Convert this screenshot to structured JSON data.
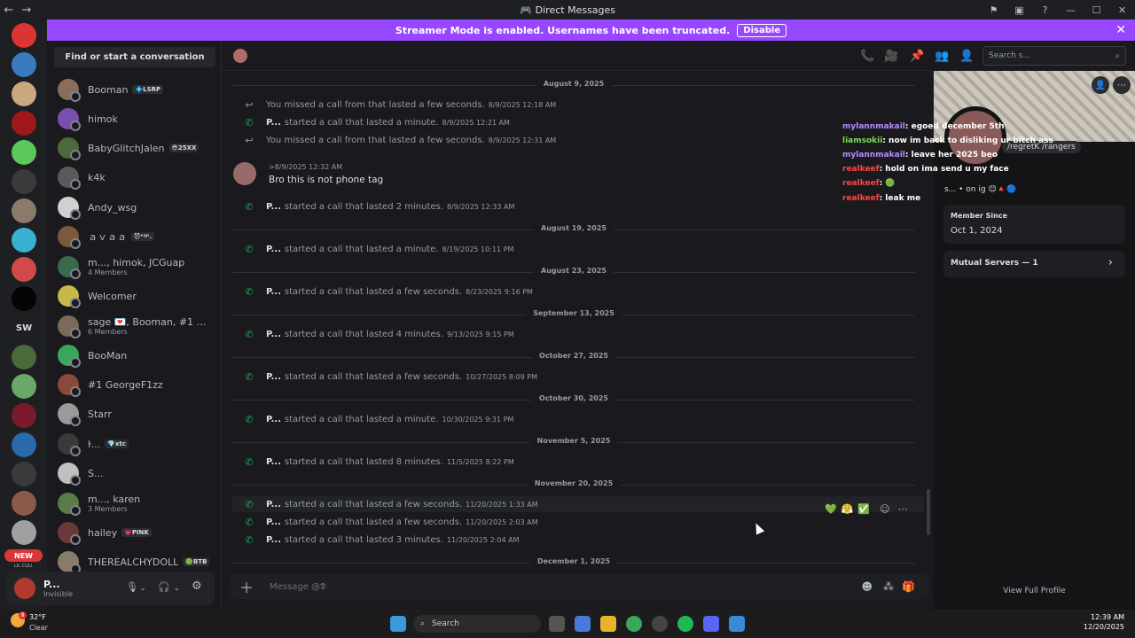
{
  "window": {
    "title": "Direct Messages",
    "back_glyph": "←",
    "forward_glyph": "→",
    "controls": [
      "⚑",
      "▣",
      "?",
      "—",
      "☐",
      "✕"
    ]
  },
  "banner": {
    "text": "Streamer Mode is enabled. Usernames have been truncated.",
    "button": "Disable",
    "close": "✕"
  },
  "rail": {
    "sw_label": "SW",
    "new_label": "NEW",
    "lilculi": "LIL CULI"
  },
  "dm_sidebar": {
    "search_label": "Find or start a conversation",
    "items": [
      {
        "name": "Booman",
        "tag": "💠LSRP",
        "sub": "",
        "color": "#8a6d5a"
      },
      {
        "name": "himok",
        "tag": "",
        "sub": "",
        "color": "#7a4fb0"
      },
      {
        "name": "BabyGlitchJalen",
        "tag": "😎25XX",
        "sub": "",
        "color": "#4b6a3a"
      },
      {
        "name": "k4k",
        "tag": "",
        "sub": "",
        "color": "#5a5a5a"
      },
      {
        "name": "Andy_wsg",
        "tag": "",
        "sub": "",
        "color": "#d0d0d0"
      },
      {
        "name": "ａｖａａ",
        "tag": "😈ᵉᵍᵖ.",
        "sub": "",
        "color": "#7a5a3a"
      },
      {
        "name": "m..., himok, JCGuap",
        "tag": "",
        "sub": "4 Members",
        "color": "#3a6a4a"
      },
      {
        "name": "Welcomer",
        "tag": "",
        "sub": "",
        "color": "#c8b84a"
      },
      {
        "name": "sage 💌, Booman, #1 George...",
        "tag": "",
        "sub": "6 Members",
        "color": "#7a6a5a"
      },
      {
        "name": "BooMan",
        "tag": "",
        "sub": "",
        "color": "#3aa85a"
      },
      {
        "name": "#1 GeorgeF1zz",
        "tag": "",
        "sub": "",
        "color": "#8a4a3a"
      },
      {
        "name": "Starr",
        "tag": "",
        "sub": "",
        "color": "#9a9a9a"
      },
      {
        "name": "ŀ...",
        "tag": "💎xtc",
        "sub": "",
        "color": "#3a3a3a"
      },
      {
        "name": "S...",
        "tag": "",
        "sub": "",
        "color": "#c0c0c0"
      },
      {
        "name": "m..., karen",
        "tag": "",
        "sub": "3 Members",
        "color": "#5a7a4a"
      },
      {
        "name": "hailey",
        "tag": "💗PINK",
        "sub": "",
        "color": "#6a3a3a"
      },
      {
        "name": "THEREALCHYDOLL",
        "tag": "🟢BTB",
        "sub": "",
        "color": "#8a7a6a"
      }
    ]
  },
  "user_panel": {
    "name": "P...",
    "status": "Invisible",
    "mic": "🎙",
    "headset": "🎧",
    "settings": "⚙"
  },
  "chat": {
    "search_placeholder": "Search s...",
    "composer_placeholder": "Message @𝕯",
    "days": [
      "August 9, 2025",
      "August 19, 2025",
      "August 23, 2025",
      "September 13, 2025",
      "October 27, 2025",
      "October 30, 2025",
      "November 5, 2025",
      "November 20, 2025",
      "December 1, 2025"
    ],
    "calls": [
      {
        "who": "",
        "text": "You missed a call from  that lasted a few seconds.",
        "ts": "8/9/2025 12:18 AM",
        "missed": true
      },
      {
        "who": "P...",
        "text": "started a call that lasted a minute.",
        "ts": "8/9/2025 12:21 AM",
        "missed": false
      },
      {
        "who": "",
        "text": "You missed a call from  that lasted a few seconds.",
        "ts": "8/9/2025 12:31 AM",
        "missed": true
      },
      {
        "who": "P...",
        "text": "started a call that lasted 2 minutes.",
        "ts": "8/9/2025 12:33 AM",
        "missed": false
      },
      {
        "who": "P...",
        "text": "started a call that lasted a minute.",
        "ts": "8/19/2025 10:11 PM",
        "missed": false
      },
      {
        "who": "P...",
        "text": "started a call that lasted a few seconds.",
        "ts": "8/23/2025 9:16 PM",
        "missed": false
      },
      {
        "who": "P...",
        "text": "started a call that lasted 4 minutes.",
        "ts": "9/13/2025 9:15 PM",
        "missed": false
      },
      {
        "who": "P...",
        "text": "started a call that lasted a few seconds.",
        "ts": "10/27/2025 8:09 PM",
        "missed": false
      },
      {
        "who": "P...",
        "text": "started a call that lasted a minute.",
        "ts": "10/30/2025 9:31 PM",
        "missed": false
      },
      {
        "who": "P...",
        "text": "started a call that lasted 8 minutes.",
        "ts": "11/5/2025 8:22 PM",
        "missed": false
      },
      {
        "who": "P...",
        "text": "started a call that lasted a few seconds.",
        "ts": "11/20/2025 1:33 AM",
        "missed": false
      },
      {
        "who": "P...",
        "text": "started a call that lasted a few seconds.",
        "ts": "11/20/2025 2:03 AM",
        "missed": false
      },
      {
        "who": "P...",
        "text": "started a call that lasted 3 minutes.",
        "ts": "11/20/2025 2:04 AM",
        "missed": false
      }
    ],
    "message": {
      "ts": "8/9/2025 12:32 AM",
      "text": "Bro this is not phone tag"
    },
    "reactions": [
      "💚",
      "😤",
      "✅"
    ]
  },
  "overlay_chat": [
    {
      "user": "mylannmakail",
      "text": ": egoed december 5th",
      "color": "#b48cff"
    },
    {
      "user": "liamsokii",
      "text": ": now im back to disliking ur bitch ass",
      "color": "#7ddc5a"
    },
    {
      "user": "mylannmakail",
      "text": ": leave her 2025 beo",
      "color": "#b48cff"
    },
    {
      "user": "realkeef",
      "text": ": hold on ima send u my face",
      "color": "#ff4444"
    },
    {
      "user": "realkeef",
      "text": ": 🟢",
      "color": "#ff4444"
    },
    {
      "user": "realkeef",
      "text": ": leak me",
      "color": "#ff4444"
    }
  ],
  "profile": {
    "stream_label": "/regretK /rangers",
    "bio": "s... • on ig 😊🔺🔵",
    "member_since_label": "Member Since",
    "member_since": "Oct 1, 2024",
    "mutual_servers": "Mutual Servers — 1",
    "view_full": "View Full Profile"
  },
  "taskbar": {
    "weather_temp": "32°F",
    "weather_desc": "Clear",
    "weather_badge": "8",
    "search": "Search",
    "time": "12:39 AM",
    "date": "12/20/2025"
  }
}
